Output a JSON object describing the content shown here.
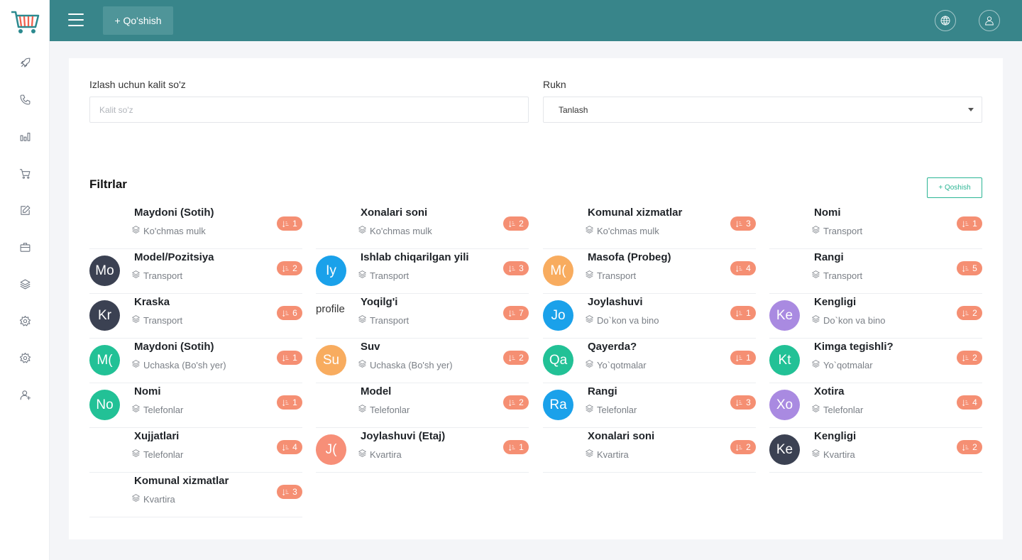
{
  "topbar": {
    "add_label": "+ Qo'shish"
  },
  "search": {
    "keyword_label": "Izlash uchun kalit so'z",
    "keyword_placeholder": "Kalit so'z",
    "category_label": "Rukn",
    "category_value": "Tanlash"
  },
  "filters": {
    "title": "Filtrlar",
    "add_label": "+ Qoshish",
    "columns": [
      [
        {
          "title": "Maydoni (Sotih)",
          "category": "Ko'chmas mulk",
          "count": "1",
          "avatar": "",
          "color": ""
        },
        {
          "title": "Model/Pozitsiya",
          "category": "Transport",
          "count": "2",
          "avatar": "Mo",
          "color": "#3b4152"
        },
        {
          "title": "Kraska",
          "category": "Transport",
          "count": "6",
          "avatar": "Kr",
          "color": "#3b4152"
        },
        {
          "title": "Maydoni (Sotih)",
          "category": "Uchaska (Bo'sh yer)",
          "count": "1",
          "avatar": "M(",
          "color": "#22c196"
        },
        {
          "title": "Nomi",
          "category": "Telefonlar",
          "count": "1",
          "avatar": "No",
          "color": "#22c196"
        },
        {
          "title": "Xujjatlari",
          "category": "Telefonlar",
          "count": "4",
          "avatar": "",
          "color": ""
        },
        {
          "title": "Komunal xizmatlar",
          "category": "Kvartira",
          "count": "3",
          "avatar": "",
          "color": ""
        }
      ],
      [
        {
          "title": "Xonalari soni",
          "category": "Ko'chmas mulk",
          "count": "2",
          "avatar": "",
          "color": ""
        },
        {
          "title": "Ishlab chiqarilgan yili",
          "category": "Transport",
          "count": "3",
          "avatar": "Iy",
          "color": "#1aa1ea"
        },
        {
          "title": "Yoqilg'i",
          "category": "Transport",
          "count": "7",
          "avatar": "",
          "color": "",
          "broken_image": "profile"
        },
        {
          "title": "Suv",
          "category": "Uchaska (Bo'sh yer)",
          "count": "2",
          "avatar": "Su",
          "color": "#f8ac5f"
        },
        {
          "title": "Model",
          "category": "Telefonlar",
          "count": "2",
          "avatar": "",
          "color": ""
        },
        {
          "title": "Joylashuvi (Etaj)",
          "category": "Kvartira",
          "count": "1",
          "avatar": "J(",
          "color": "#f78f78"
        }
      ],
      [
        {
          "title": "Komunal xizmatlar",
          "category": "Ko'chmas mulk",
          "count": "3",
          "avatar": "",
          "color": ""
        },
        {
          "title": "Masofa (Probeg)",
          "category": "Transport",
          "count": "4",
          "avatar": "M(",
          "color": "#f8ac5f"
        },
        {
          "title": "Joylashuvi",
          "category": "Do`kon va bino",
          "count": "1",
          "avatar": "Jo",
          "color": "#1aa1ea"
        },
        {
          "title": "Qayerda?",
          "category": "Yo`qotmalar",
          "count": "1",
          "avatar": "Qa",
          "color": "#22c196"
        },
        {
          "title": "Rangi",
          "category": "Telefonlar",
          "count": "3",
          "avatar": "Ra",
          "color": "#1aa1ea"
        },
        {
          "title": "Xonalari soni",
          "category": "Kvartira",
          "count": "2",
          "avatar": "",
          "color": ""
        }
      ],
      [
        {
          "title": "Nomi",
          "category": "Transport",
          "count": "1",
          "avatar": "",
          "color": ""
        },
        {
          "title": "Rangi",
          "category": "Transport",
          "count": "5",
          "avatar": "",
          "color": ""
        },
        {
          "title": "Kengligi",
          "category": "Do`kon va bino",
          "count": "2",
          "avatar": "Ke",
          "color": "#a98ae1"
        },
        {
          "title": "Kimga tegishli?",
          "category": "Yo`qotmalar",
          "count": "2",
          "avatar": "Kt",
          "color": "#22c196"
        },
        {
          "title": "Xotira",
          "category": "Telefonlar",
          "count": "4",
          "avatar": "Xo",
          "color": "#a98ae1"
        },
        {
          "title": "Kengligi",
          "category": "Kvartira",
          "count": "2",
          "avatar": "Ke",
          "color": "#3b4152"
        }
      ]
    ]
  },
  "sidebar": {
    "icons": [
      "rocket-icon",
      "phone-icon",
      "bar-chart-icon",
      "cart-icon",
      "edit-icon",
      "briefcase-icon",
      "layers-icon",
      "settings-icon",
      "settings-icon",
      "user-icon"
    ]
  },
  "colors": {
    "topbar": "#38858a",
    "accent": "#2bb594",
    "badge": "#f58f73"
  }
}
